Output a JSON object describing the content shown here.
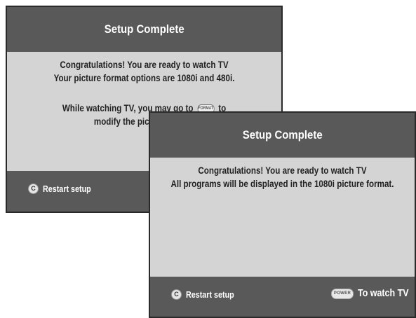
{
  "screens": [
    {
      "title": "Setup Complete",
      "message_lines": [
        "Congratulations!  You are ready to watch TV",
        "Your picture format options are 1080i and 480i."
      ],
      "hint_before": "While watching TV, you may go to",
      "hint_key_label": "FORMAT",
      "hint_after": "to",
      "hint_line2": "modify the picture format.",
      "restart_label": "Restart setup",
      "restart_key_icon": "C"
    },
    {
      "title": "Setup Complete",
      "message_lines": [
        "Congratulations!  You are ready to watch TV",
        "All programs will be displayed in the 1080i picture format."
      ],
      "restart_label": "Restart setup",
      "restart_key_icon": "C",
      "watch_label": "To watch TV",
      "power_key_label": "POWER"
    }
  ],
  "colors": {
    "header_footer": "#595959",
    "panel": "#d4d4d4",
    "text_light": "#ffffff",
    "text_dark": "#222222"
  }
}
